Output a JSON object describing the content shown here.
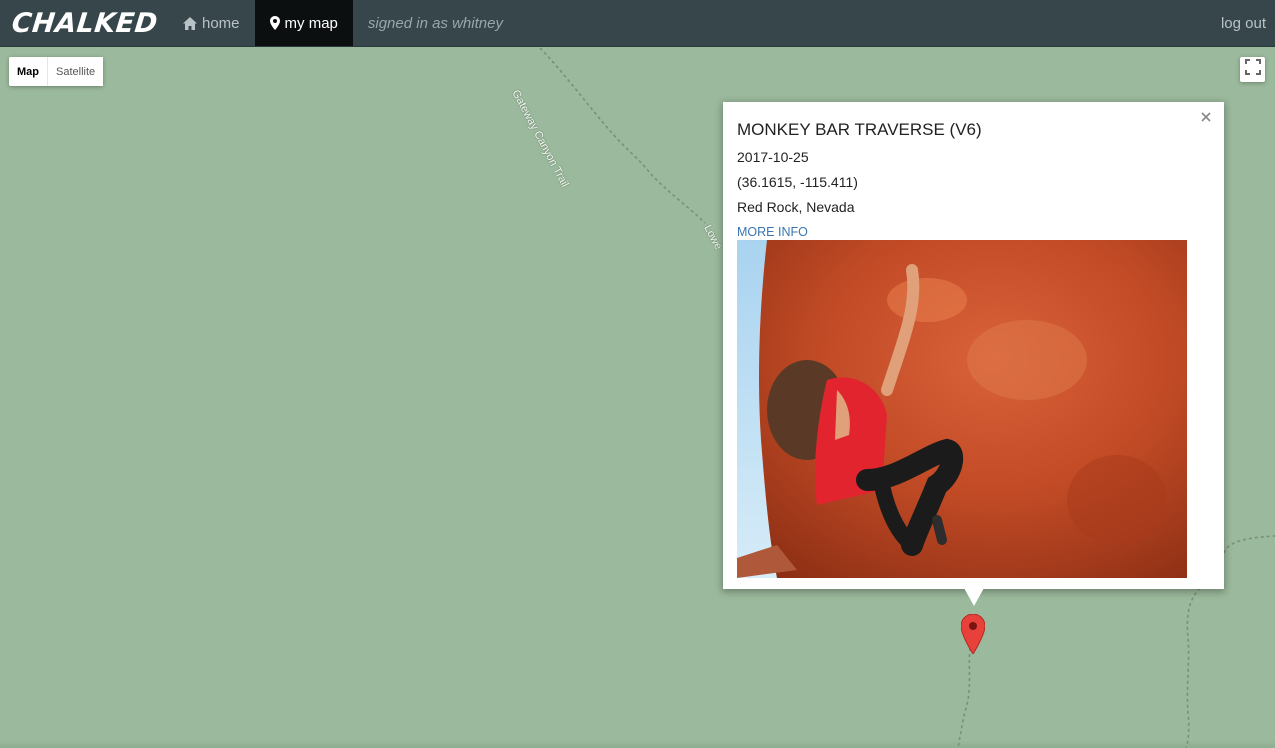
{
  "nav": {
    "brand": "CHALKED",
    "items": [
      {
        "label": "home",
        "icon": "home-icon",
        "active": false
      },
      {
        "label": "my map",
        "icon": "map-pin-icon",
        "active": true
      }
    ],
    "signed_in_text": "signed in as whitney",
    "logout_label": "log out"
  },
  "map": {
    "map_type_options": [
      "Map",
      "Satellite"
    ],
    "selected_map_type": "Map",
    "trail_labels": [
      "Gateway Canyon Trail",
      "Lowe"
    ],
    "fullscreen_icon": "fullscreen-icon"
  },
  "infowindow": {
    "title": "MONKEY BAR TRAVERSE (V6)",
    "date": "2017-10-25",
    "coords": "(36.1615, -115.411)",
    "location": "Red Rock, Nevada",
    "more_info_label": "MORE INFO",
    "close_icon": "close-icon",
    "photo_alt": "climber-photo"
  },
  "colors": {
    "navbar": "#36464b",
    "active_nav": "#0c0f10",
    "map_bg": "#9bb99c",
    "link": "#3a75b0",
    "marker": "#e8413b"
  }
}
